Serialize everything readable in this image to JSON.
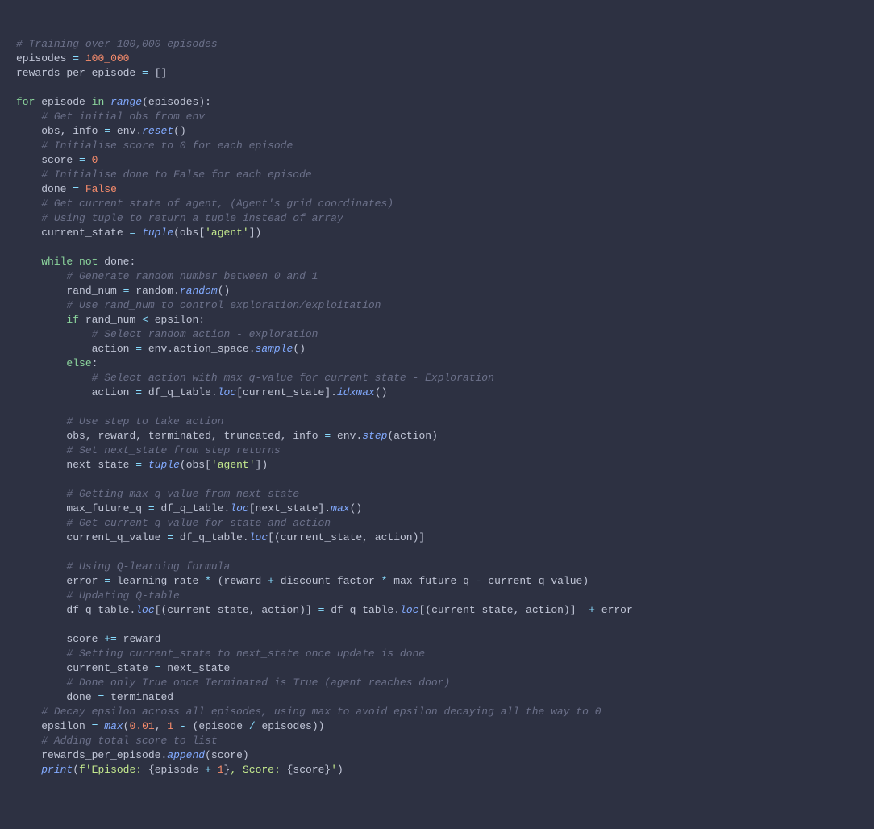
{
  "code": {
    "l01": "# Training over 100,000 episodes",
    "l02a": "episodes",
    "l02b": "=",
    "l02c": "100_000",
    "l03a": "rewards_per_episode",
    "l03b": "=",
    "l03c": "[]",
    "l05a": "for",
    "l05b": "episode",
    "l05c": "in",
    "l05d": "range",
    "l05e": "(",
    "l05f": "episodes",
    "l05g": ")",
    "l05h": ":",
    "l06": "# Get initial obs from env",
    "l07a": "obs",
    "l07b": ",",
    "l07c": "info",
    "l07d": "=",
    "l07e": "env",
    "l07f": ".",
    "l07g": "reset",
    "l07h": "(",
    "l07i": ")",
    "l08": "# Initialise score to 0 for each episode",
    "l09a": "score",
    "l09b": "=",
    "l09c": "0",
    "l10": "# Initialise done to False for each episode",
    "l11a": "done",
    "l11b": "=",
    "l11c": "False",
    "l12": "# Get current state of agent, (Agent's grid coordinates)",
    "l13": "# Using tuple to return a tuple instead of array",
    "l14a": "current_state",
    "l14b": "=",
    "l14c": "tuple",
    "l14d": "(",
    "l14e": "obs",
    "l14f": "[",
    "l14g": "'agent'",
    "l14h": "]",
    "l14i": ")",
    "l16a": "while",
    "l16b": "not",
    "l16c": "done",
    "l16d": ":",
    "l17": "# Generate random number between 0 and 1",
    "l18a": "rand_num",
    "l18b": "=",
    "l18c": "random",
    "l18d": ".",
    "l18e": "random",
    "l18f": "(",
    "l18g": ")",
    "l19": "# Use rand_num to control exploration/exploitation",
    "l20a": "if",
    "l20b": "rand_num",
    "l20c": "<",
    "l20d": "epsilon",
    "l20e": ":",
    "l21": "# Select random action - exploration",
    "l22a": "action",
    "l22b": "=",
    "l22c": "env",
    "l22d": ".",
    "l22e": "action_space",
    "l22f": ".",
    "l22g": "sample",
    "l22h": "(",
    "l22i": ")",
    "l23a": "else",
    "l23b": ":",
    "l24": "# Select action with max q-value for current state - Exploration",
    "l25a": "action",
    "l25b": "=",
    "l25c": "df_q_table",
    "l25d": ".",
    "l25e": "loc",
    "l25f": "[",
    "l25g": "current_state",
    "l25h": "]",
    "l25i": ".",
    "l25j": "idxmax",
    "l25k": "(",
    "l25l": ")",
    "l27": "# Use step to take action",
    "l28a": "obs",
    "l28b": ",",
    "l28c": "reward",
    "l28d": ",",
    "l28e": "terminated",
    "l28f": ",",
    "l28g": "truncated",
    "l28h": ",",
    "l28i": "info",
    "l28j": "=",
    "l28k": "env",
    "l28l": ".",
    "l28m": "step",
    "l28n": "(",
    "l28o": "action",
    "l28p": ")",
    "l29": "# Set next_state from step returns",
    "l30a": "next_state",
    "l30b": "=",
    "l30c": "tuple",
    "l30d": "(",
    "l30e": "obs",
    "l30f": "[",
    "l30g": "'agent'",
    "l30h": "]",
    "l30i": ")",
    "l32": "# Getting max q-value from next_state",
    "l33a": "max_future_q",
    "l33b": "=",
    "l33c": "df_q_table",
    "l33d": ".",
    "l33e": "loc",
    "l33f": "[",
    "l33g": "next_state",
    "l33h": "]",
    "l33i": ".",
    "l33j": "max",
    "l33k": "(",
    "l33l": ")",
    "l34": "# Get current q_value for state and action",
    "l35a": "current_q_value",
    "l35b": "=",
    "l35c": "df_q_table",
    "l35d": ".",
    "l35e": "loc",
    "l35f": "[",
    "l35g": "(",
    "l35h": "current_state",
    "l35i": ",",
    "l35j": "action",
    "l35k": ")",
    "l35l": "]",
    "l37": "# Using Q-learning formula",
    "l38a": "error",
    "l38b": "=",
    "l38c": "learning_rate",
    "l38d": "*",
    "l38e": "(",
    "l38f": "reward",
    "l38g": "+",
    "l38h": "discount_factor",
    "l38i": "*",
    "l38j": "max_future_q",
    "l38k": "-",
    "l38l": "current_q_value",
    "l38m": ")",
    "l39": "# Updating Q-table",
    "l40a": "df_q_table",
    "l40b": ".",
    "l40c": "loc",
    "l40d": "[",
    "l40e": "(",
    "l40f": "current_state",
    "l40g": ",",
    "l40h": "action",
    "l40i": ")",
    "l40j": "]",
    "l40k": "=",
    "l40l": "df_q_table",
    "l40m": ".",
    "l40n": "loc",
    "l40o": "[",
    "l40p": "(",
    "l40q": "current_state",
    "l40r": ",",
    "l40s": "action",
    "l40t": ")",
    "l40u": "]",
    "l40v": "+",
    "l40w": "error",
    "l42a": "score",
    "l42b": "+=",
    "l42c": "reward",
    "l43": "# Setting current_state to next_state once update is done",
    "l44a": "current_state",
    "l44b": "=",
    "l44c": "next_state",
    "l45": "# Done only True once Terminated is True (agent reaches door)",
    "l46a": "done",
    "l46b": "=",
    "l46c": "terminated",
    "l47": "# Decay epsilon across all episodes, using max to avoid epsilon decaying all the way to 0",
    "l48a": "epsilon",
    "l48b": "=",
    "l48c": "max",
    "l48d": "(",
    "l48e": "0.01",
    "l48f": ",",
    "l48g": "1",
    "l48h": "-",
    "l48i": "(",
    "l48j": "episode",
    "l48k": "/",
    "l48l": "episodes",
    "l48m": ")",
    "l48n": ")",
    "l49": "# Adding total score to list",
    "l50a": "rewards_per_episode",
    "l50b": ".",
    "l50c": "append",
    "l50d": "(",
    "l50e": "score",
    "l50f": ")",
    "l51a": "print",
    "l51b": "(",
    "l51c": "f",
    "l51d": "'Episode: ",
    "l51e": "{",
    "l51f": "episode",
    "l51g": "+",
    "l51h": "1",
    "l51i": "}",
    "l51j": ", Score: ",
    "l51k": "{",
    "l51l": "score",
    "l51m": "}",
    "l51n": "'",
    "l51o": ")"
  }
}
